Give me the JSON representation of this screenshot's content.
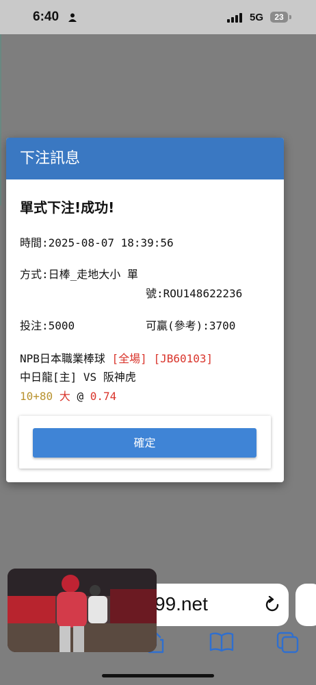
{
  "status_bar": {
    "time": "6:40",
    "network": "5G",
    "battery": "23"
  },
  "modal": {
    "header_title": "下注訊息",
    "result_title": "單式下注!成功!",
    "time_label": "時間:",
    "time_value": "2025-08-07 18:39:56",
    "method_label": "方式:",
    "method_value": "日棒_走地大小 單",
    "ticket_label": "號:",
    "ticket_value": "ROU148622236",
    "stake_label": "投注:",
    "stake_value": "5000",
    "win_label": "可贏(參考):",
    "win_value": "3700",
    "league": "NPB日本職業棒球",
    "period": "[全場]",
    "match_code": "[JB60103]",
    "home_team": "中日龍[主]",
    "vs": "VS",
    "away_team": "阪神虎",
    "line": "10+80",
    "pick": "大",
    "at": "@",
    "odds": "0.74",
    "confirm_label": "確定"
  },
  "browser": {
    "url": "99.net"
  },
  "colors": {
    "header_blue": "#3a78c2",
    "button_blue": "#3f84d6",
    "highlight_red": "#d9342b",
    "line_gold": "#b8922e"
  },
  "icons": [
    "person-icon",
    "signal-icon",
    "battery-icon",
    "reload-icon",
    "share-icon",
    "bookmarks-icon",
    "tabs-icon"
  ]
}
